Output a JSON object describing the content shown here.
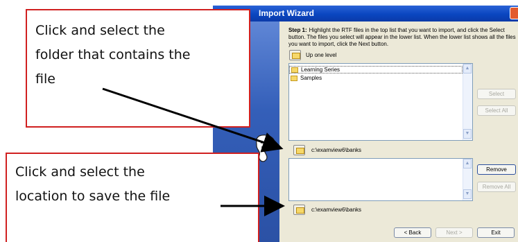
{
  "window": {
    "title_partial": "Import Wizard"
  },
  "step": {
    "label": "Step 1:",
    "text": "Highlight the RTF files in the top list that you want to import, and click the Select button.  The files you select will appear in the lower list.  When the lower list shows all the files you want to import, click the Next button."
  },
  "up_level": {
    "label": "Up one level"
  },
  "top_list": {
    "items": [
      "Learning Series",
      "Samples"
    ]
  },
  "buttons": {
    "select": "Select",
    "select_all": "Select All",
    "remove": "Remove",
    "remove_all": "Remove All",
    "back": "< Back",
    "next": "Next >",
    "exit": "Exit"
  },
  "source_path": "c:\\examview6\\banks",
  "dest_path": "c:\\examview6\\banks",
  "callouts": {
    "top": [
      "Click and select the",
      "folder that contains the",
      "file"
    ],
    "bottom": [
      "Click and select the",
      "location to save the file"
    ]
  },
  "colors": {
    "callout_border": "#d02020",
    "titlebar": "#0a46c0",
    "accent": "#2b51a5"
  }
}
